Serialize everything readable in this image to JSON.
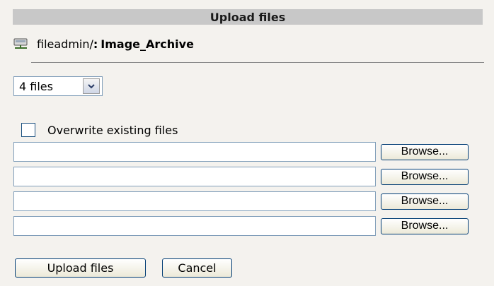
{
  "header": {
    "title": "Upload files"
  },
  "path": {
    "prefix": "fileadmin/",
    "separator": ":",
    "folder": "Image_Archive",
    "icon": "folder-tree-icon"
  },
  "file_count_select": {
    "selected": "4 files",
    "icon": "chevron-down-icon"
  },
  "overwrite": {
    "label": "Overwrite existing files",
    "checked": false
  },
  "file_inputs": [
    {
      "value": "",
      "browse_label": "Browse..."
    },
    {
      "value": "",
      "browse_label": "Browse..."
    },
    {
      "value": "",
      "browse_label": "Browse..."
    },
    {
      "value": "",
      "browse_label": "Browse..."
    }
  ],
  "actions": {
    "upload_label": "Upload files",
    "cancel_label": "Cancel"
  },
  "colors": {
    "header_bg": "#c8c8c8",
    "page_bg": "#f4f2ee",
    "border": "#7f9db9",
    "button_border": "#003c74"
  }
}
